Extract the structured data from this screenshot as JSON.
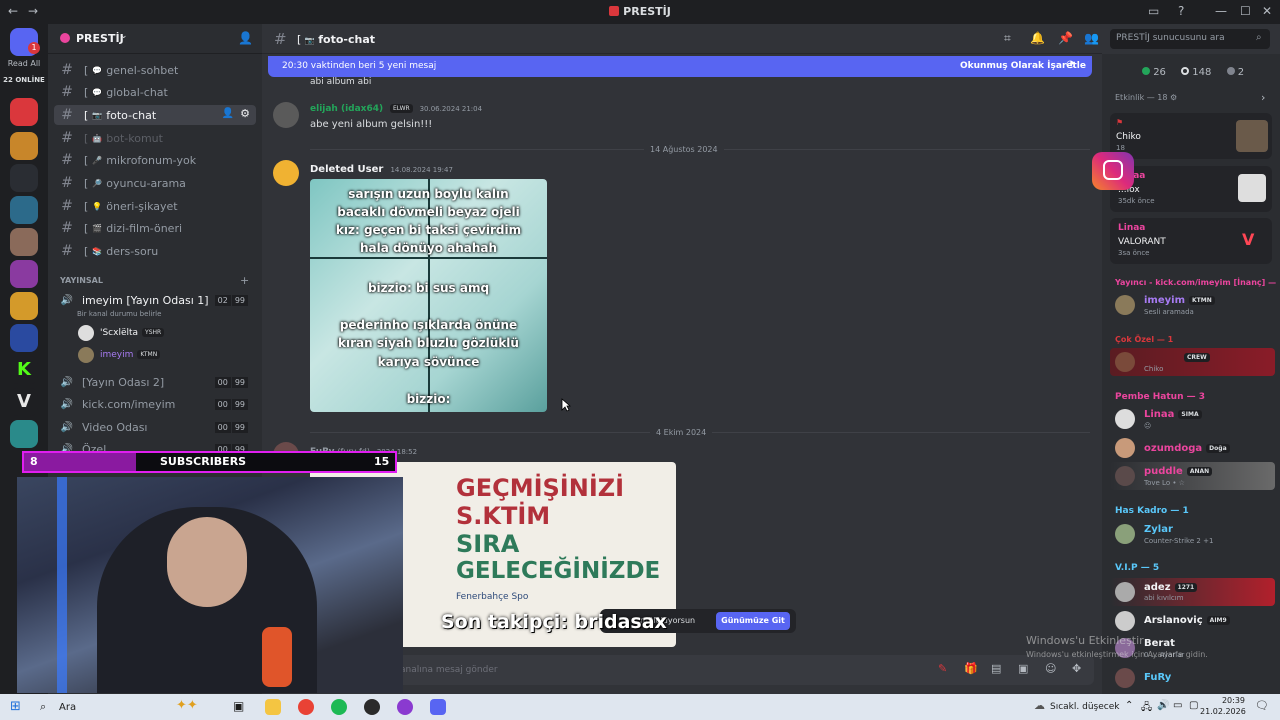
{
  "window": {
    "title": "PRESTİJ"
  },
  "rail": {
    "read_all": "Read All",
    "online": "22 ONLİNE",
    "badge": "1",
    "notif": "3"
  },
  "server": {
    "name": "PRESTİJ"
  },
  "channels": [
    {
      "bracket": "[",
      "emoji": "💬",
      "label": "genel-sohbet"
    },
    {
      "bracket": "[",
      "emoji": "💬",
      "label": "global-chat"
    },
    {
      "bracket": "[",
      "emoji": "📷",
      "label": "foto-chat"
    },
    {
      "bracket": "[",
      "emoji": "🤖",
      "label": "bot-komut"
    },
    {
      "bracket": "[",
      "emoji": "🎤",
      "label": "mikrofonum-yok"
    },
    {
      "bracket": "[",
      "emoji": "🔎",
      "label": "oyuncu-arama"
    },
    {
      "bracket": "[",
      "emoji": "💡",
      "label": "öneri-şikayet"
    },
    {
      "bracket": "[",
      "emoji": "🎬",
      "label": "dizi-film-öneri"
    },
    {
      "bracket": "[",
      "emoji": "📚",
      "label": "ders-soru"
    }
  ],
  "voice": {
    "category": "YAYINSAL",
    "room1": {
      "label": "imeyim [Yayın Odası 1]",
      "status": "Bir kanal durumu belirle",
      "c1": "02",
      "c2": "99"
    },
    "users": [
      {
        "name": "'Scxlëlta",
        "tag": "YSHR"
      },
      {
        "name": "imeyim",
        "tag": "KTMN"
      }
    ],
    "room2": {
      "label": "[Yayın Odası 2]",
      "c1": "00",
      "c2": "99"
    },
    "room3": {
      "label": "kick.com/imeyim",
      "c1": "00",
      "c2": "99"
    },
    "room4": {
      "label": "Video Odası",
      "c1": "00",
      "c2": "99"
    },
    "room5": {
      "label": "Özel",
      "c1": "00",
      "c2": "99"
    }
  },
  "chat": {
    "channel_bracket": "[",
    "channel_emoji": "📷",
    "channel_name": "foto-chat",
    "search_placeholder": "PRESTİJ sunucusunu ara",
    "new_since": "20:30 vaktinden beri 5 yeni mesaj",
    "mark_read": "Okunmuş Olarak İşaretle",
    "partial_text": "abi album abi",
    "msg1": {
      "author": "elijah (idax64)",
      "tag": "ELWR",
      "time": "30.06.2024 21:04",
      "text": "abe yeni album gelsin!!!"
    },
    "date1": "14 Ağustos 2024",
    "msg2": {
      "author": "Deleted User",
      "time": "14.08.2024 19:47"
    },
    "meme1_lines": [
      "sarışın uzun boylu kalın",
      "bacaklı dövmeli beyaz ojeli",
      "kız: geçen bi taksi çevirdim",
      "hala dönüyo ahahah",
      "bizzio: bi sus amq",
      "pederinho ışıklarda önüne",
      "kıran siyah bluzlu gözlüklü",
      "karıya sövünce",
      "bizzio:"
    ],
    "date2": "4 Ekim 2024",
    "msg3": {
      "author": "FuRy",
      "alt": "(fury fd)",
      "time": "2024 18:52"
    },
    "meme2_lines": [
      "GEÇMİŞİNİZİ",
      "S.KTİM",
      "SIRA",
      "GELECEĞİNİZDE"
    ],
    "meme2_footer": "Fenerbahçe Spo",
    "older_notice": "ntülülüyorsun",
    "jump_button": "Günümüze Git",
    "composer_placeholder": "analına mesaj gönder"
  },
  "members": {
    "stats": {
      "online": "26",
      "offline": "148",
      "other": "2"
    },
    "activity_header": "Etkinlik — 18",
    "activities": [
      {
        "name": "Chiko",
        "sub": "18",
        "red_name": ""
      },
      {
        "name": "Linaa",
        "game": "...lox",
        "sub": "35dk önce"
      },
      {
        "name": "Linaa",
        "game": "VALORANT",
        "sub": "3sa önce"
      }
    ],
    "group_streamer": "Yayıncı - kick.com/imeyim [İnanç] —",
    "streamer": {
      "name": "imeyim",
      "tag": "KTMN",
      "sub": "Sesli aramada"
    },
    "group_crew": "Çok Özel — 1",
    "crew_member": {
      "tag": "CREW",
      "sub": "Chiko"
    },
    "group_pink": "Pembe Hatun — 3",
    "pink": [
      {
        "name": "Linaa",
        "tag": "SIMA",
        "sub": "😐"
      },
      {
        "name": "ozumdoga",
        "tag": "Doğa",
        "sub": ""
      },
      {
        "name": "puddle",
        "tag": "ANAN",
        "sub": "Tove Lo • ☆"
      }
    ],
    "group_has": "Has Kadro — 1",
    "has": {
      "name": "Zylar",
      "sub": "Counter-Strike 2 +1"
    },
    "group_vip": "V.I.P — 5",
    "vip": [
      {
        "name": "adez",
        "tag": "1271",
        "sub": "abi kıvılcım"
      },
      {
        "name": "Arslanoviç",
        "tag": "AIM9",
        "sub": ""
      },
      {
        "name": "Berat",
        "tag": "",
        "sub": "0 ... Ayarlar"
      },
      {
        "name": "FuRy",
        "tag": "",
        "sub": ""
      }
    ]
  },
  "overlay": {
    "sub_left": "8",
    "sub_label": "SUBSCRIBERS",
    "sub_right": "15",
    "follower": "Son takipçi: bridasax",
    "watermark1": "Windows'u Etkinleştir",
    "watermark2": "Windows'u etkinleştirmek için Ayarlar'a gidin."
  },
  "taskbar": {
    "search": "Ara",
    "weather": "Sıcakl. düşecek",
    "time": "20:39",
    "date": "21.02.2026"
  },
  "colors": {
    "accent": "#5865f2",
    "online": "#23a55a",
    "pink": "#eb459e",
    "red": "#da373c"
  }
}
